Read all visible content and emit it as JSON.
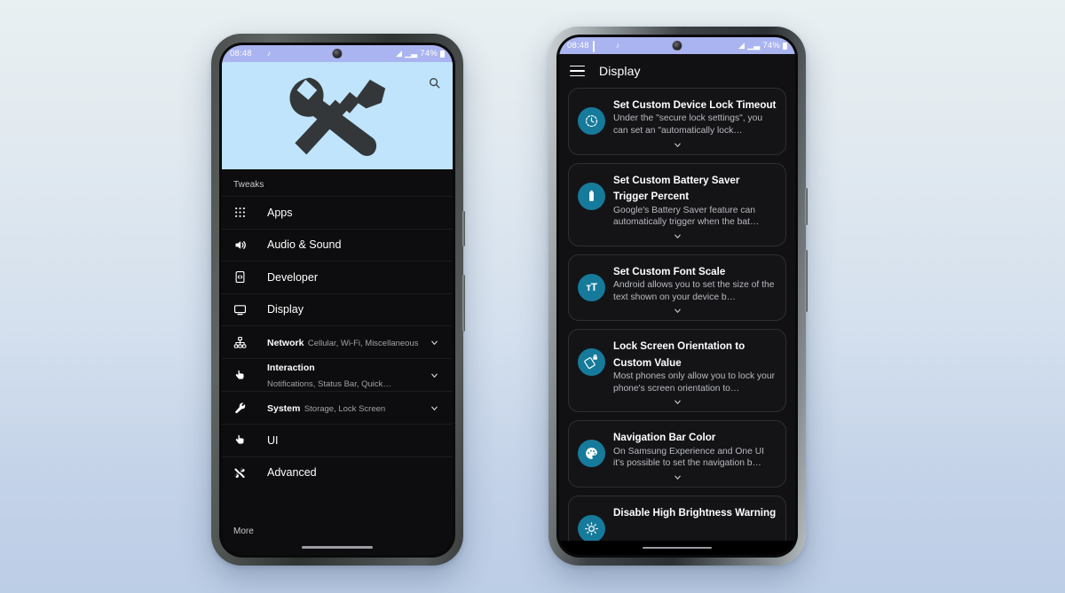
{
  "background": {
    "top_color": "#e9f0f2",
    "bottom_color": "#bccde6"
  },
  "accent": {
    "hero_bg": "#bfe4fb",
    "circle_teal": "#167a9b",
    "statusbar_bg": "#aab4f0"
  },
  "left_phone": {
    "status_bar": {
      "time": "08:48",
      "icons": [
        "record-dot-icon",
        "bluetooth-audio-icon",
        "cloud-icon",
        "dot-icon"
      ],
      "right_icons": [
        "wifi-icon",
        "cellular-signal-icon"
      ],
      "battery_percent": "74%"
    },
    "hero": {
      "logo": "wrench-and-screwdriver-icon",
      "search_icon": "search-icon"
    },
    "section_label": "Tweaks",
    "footer_label": "More",
    "menu": [
      {
        "icon": "grid-apps-icon",
        "title": "Apps",
        "sub": "",
        "expandable": false
      },
      {
        "icon": "speaker-icon",
        "title": "Audio & Sound",
        "sub": "",
        "expandable": false
      },
      {
        "icon": "developer-icon",
        "title": "Developer",
        "sub": "",
        "expandable": false
      },
      {
        "icon": "monitor-icon",
        "title": "Display",
        "sub": "",
        "expandable": false
      },
      {
        "icon": "network-tree-icon",
        "title": "Network",
        "sub": "Cellular, Wi-Fi, Miscellaneous",
        "expandable": true
      },
      {
        "icon": "tap-finger-icon",
        "title": "Interaction",
        "sub": "Notifications, Status Bar, Quick…",
        "expandable": true
      },
      {
        "icon": "wrench-icon",
        "title": "System",
        "sub": "Storage, Lock Screen",
        "expandable": true
      },
      {
        "icon": "tap-finger-icon",
        "title": "UI",
        "sub": "",
        "expandable": false
      },
      {
        "icon": "tools-cross-icon",
        "title": "Advanced",
        "sub": "",
        "expandable": false
      }
    ]
  },
  "right_phone": {
    "status_bar": {
      "time": "08:48",
      "icons": [
        "screenshot-icon",
        "record-dot-icon",
        "bluetooth-audio-icon",
        "dot-icon"
      ],
      "right_icons": [
        "wifi-icon",
        "cellular-signal-icon"
      ],
      "battery_percent": "74%"
    },
    "app_bar": {
      "menu_icon": "hamburger-menu-icon",
      "title": "Display"
    },
    "cards": [
      {
        "icon": "clock-timeout-icon",
        "title": "Set Custom Device Lock Timeout",
        "desc": "Under the \"secure lock settings\", you can set an \"automatically lock…",
        "expand_icon": "chevron-down-icon"
      },
      {
        "icon": "battery-icon",
        "title": "Set Custom Battery Saver Trigger Percent",
        "desc": "Google's Battery Saver feature can automatically trigger when the bat…",
        "expand_icon": "chevron-down-icon"
      },
      {
        "icon": "font-size-icon",
        "title": "Set Custom Font Scale",
        "desc": "Android allows you to set the size of the text shown on your device b…",
        "expand_icon": "chevron-down-icon"
      },
      {
        "icon": "screen-rotation-lock-icon",
        "title": "Lock Screen Orientation to Custom Value",
        "desc": "Most phones only allow you to lock your phone's screen orientation to…",
        "expand_icon": "chevron-down-icon"
      },
      {
        "icon": "palette-icon",
        "title": "Navigation Bar Color",
        "desc": "On Samsung Experience and One UI it's possible to set the navigation b…",
        "expand_icon": "chevron-down-icon"
      },
      {
        "icon": "brightness-icon",
        "title": "Disable High Brightness Warning",
        "desc": "",
        "expand_icon": "chevron-down-icon"
      }
    ]
  }
}
